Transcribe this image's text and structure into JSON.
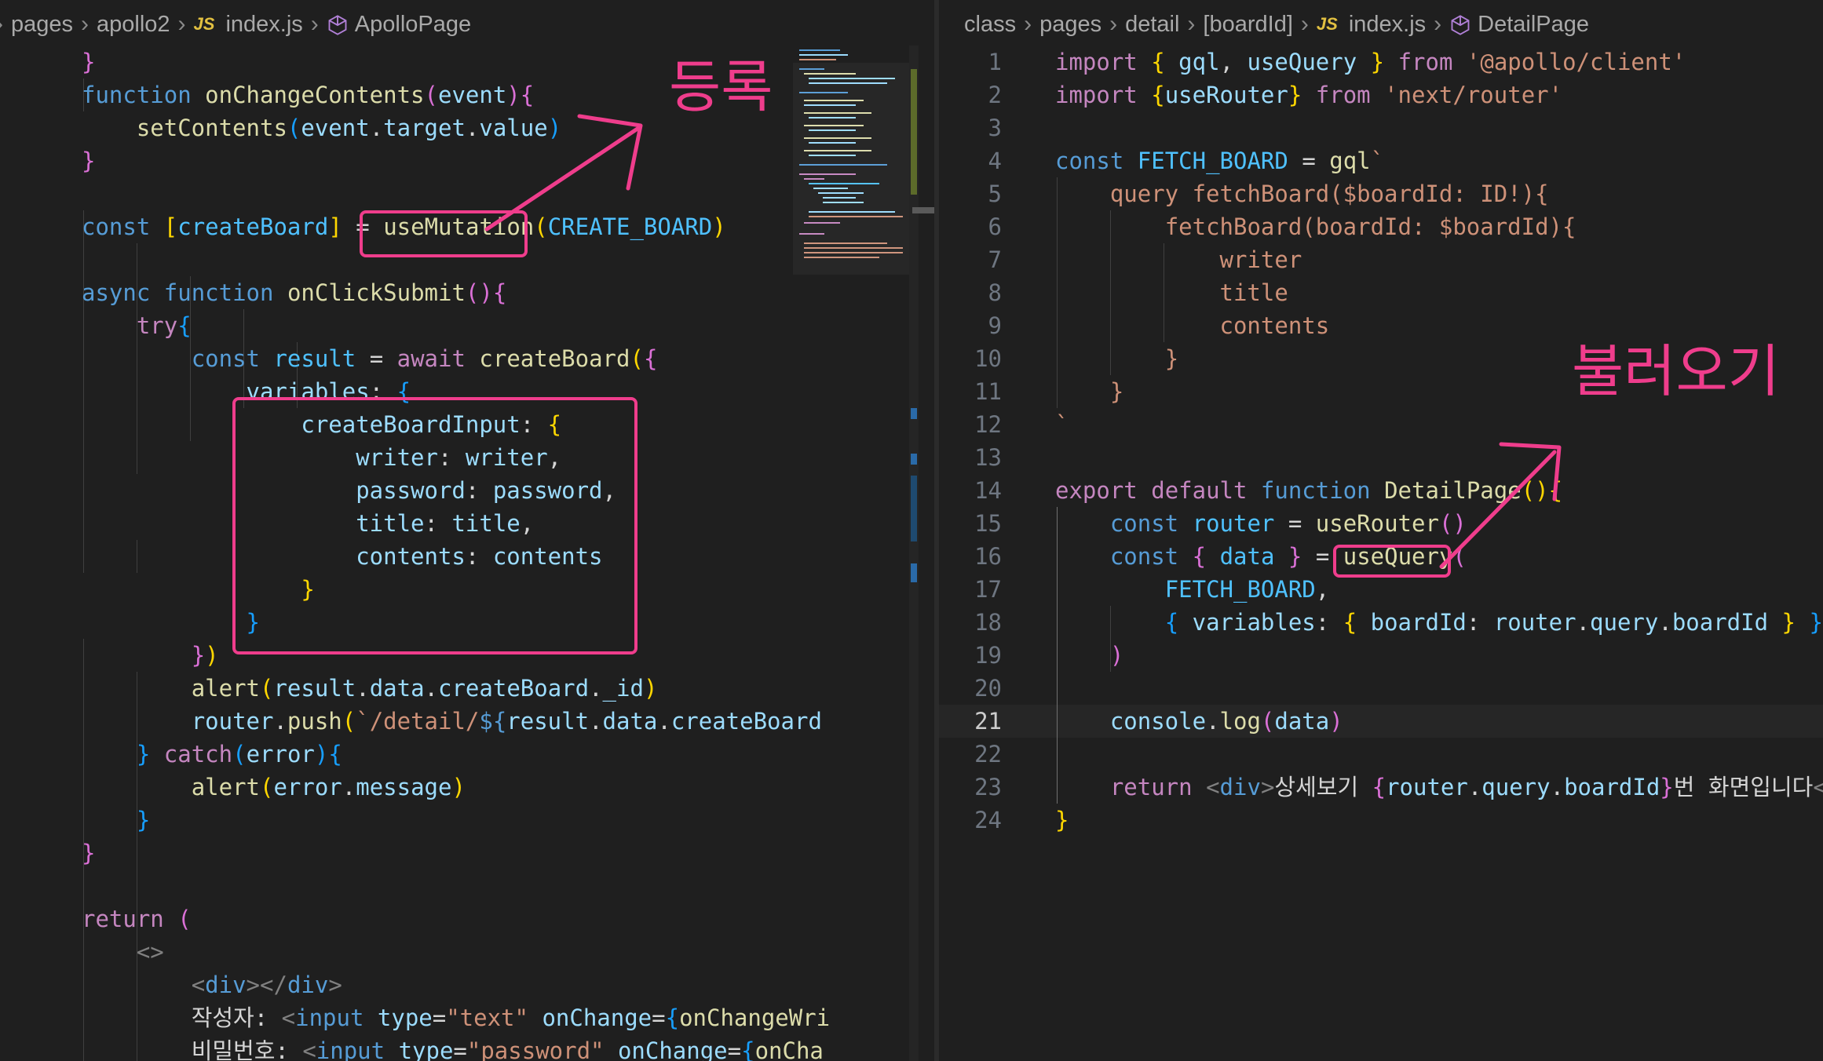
{
  "left_pane": {
    "breadcrumb": [
      "pages",
      "apollo2",
      "index.js",
      "ApolloPage"
    ],
    "file_badge": "JS"
  },
  "right_pane": {
    "breadcrumb": [
      "class",
      "pages",
      "detail",
      "[boardId]",
      "index.js",
      "DetailPage"
    ],
    "file_badge": "JS",
    "line_numbers": [
      "1",
      "2",
      "3",
      "4",
      "5",
      "6",
      "7",
      "8",
      "9",
      "10",
      "11",
      "12",
      "13",
      "14",
      "15",
      "16",
      "17",
      "18",
      "19",
      "20",
      "21",
      "22",
      "23",
      "24"
    ],
    "active_line": "21"
  },
  "annotations": {
    "register": "등록",
    "fetch": "불러오기"
  },
  "colors": {
    "annotation": "#ef3d8c",
    "background": "#1f1f1f"
  },
  "code_text": {
    "input_writer_label": "작성자: ",
    "input_password_label": "비밀번호: ",
    "detail_div_text": "상세보기 ",
    "detail_div_suffix": "번 화면입니다"
  }
}
